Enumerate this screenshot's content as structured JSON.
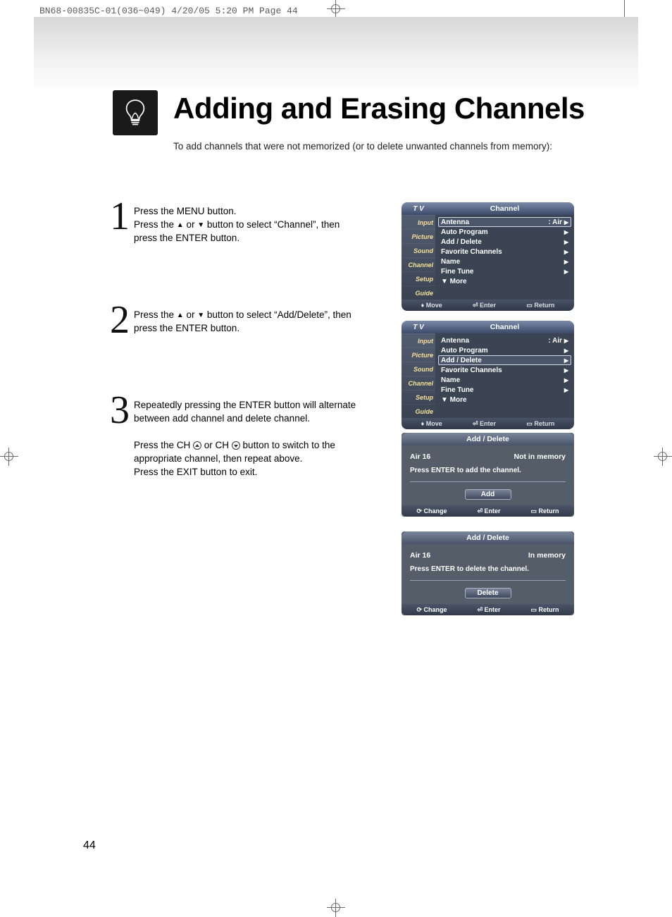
{
  "topmark": "BN68-00835C-01(036~049)  4/20/05  5:20 PM  Page 44",
  "heading": "Adding and Erasing Channels",
  "subheading": "To add channels that were not memorized (or to delete unwanted channels from memory):",
  "steps": {
    "s1": {
      "num": "1",
      "l1": "Press the MENU button.",
      "l2a": "Press the ",
      "l2b": " or ",
      "l2c": " button to select “Channel”, then",
      "l3": "press the ENTER button."
    },
    "s2": {
      "num": "2",
      "l1a": "Press the ",
      "l1b": " or ",
      "l1c": " button to select “Add/Delete”, then",
      "l2": "press the ENTER button."
    },
    "s3": {
      "num": "3",
      "l1": "Repeatedly pressing the ENTER button will alternate",
      "l2": "between add channel and delete channel.",
      "l3a": "Press the CH ",
      "l3b": " or CH ",
      "l3c": " button to switch to the",
      "l4": "appropriate channel, then repeat above.",
      "l5": "Press the EXIT button to exit."
    }
  },
  "osd": {
    "titlebar": {
      "tv": "T V",
      "section": "Channel"
    },
    "sidebar": [
      "Input",
      "Picture",
      "Sound",
      "Channel",
      "Setup",
      "Guide"
    ],
    "items": [
      {
        "label": "Antenna",
        "value": ": Air"
      },
      {
        "label": "Auto Program",
        "value": ""
      },
      {
        "label": "Add / Delete",
        "value": ""
      },
      {
        "label": "Favorite Channels",
        "value": ""
      },
      {
        "label": "Name",
        "value": ""
      },
      {
        "label": "Fine Tune",
        "value": ""
      },
      {
        "label": "▼ More",
        "value": "",
        "noarrow": true
      }
    ],
    "footer": {
      "move": "Move",
      "enter": "Enter",
      "return": "Return"
    },
    "selected1": 0,
    "selected2": 2
  },
  "panels": {
    "title": "Add / Delete",
    "p1": {
      "ch": "Air  16",
      "status": "Not in memory",
      "prompt": "Press ENTER to add the channel.",
      "btn": "Add"
    },
    "p2": {
      "ch": "Air  16",
      "status": "In memory",
      "prompt": "Press ENTER to delete the channel.",
      "btn": "Delete"
    },
    "footer": {
      "change": "Change",
      "enter": "Enter",
      "return": "Return"
    }
  },
  "pagenum": "44"
}
